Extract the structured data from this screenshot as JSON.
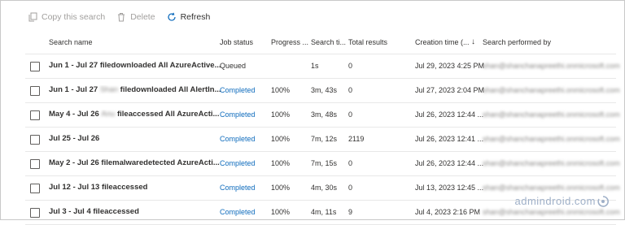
{
  "toolbar": {
    "copy_label": "Copy this search",
    "delete_label": "Delete",
    "refresh_label": "Refresh"
  },
  "columns": {
    "name": "Search name",
    "status": "Job status",
    "progress": "Progress ...",
    "search_time": "Search ti...",
    "total": "Total results",
    "created": "Creation time (...",
    "sort_indicator": "↓",
    "performed_by": "Search performed by"
  },
  "rows": [
    {
      "name": "Jun 1 - Jul 27 filedownloaded All AzureActive...",
      "name_blur": "",
      "status": "Queued",
      "status_done": false,
      "progress": "",
      "search_time": "1s",
      "total": "0",
      "created": "Jul 29, 2023 4:25 PM",
      "performed_by": "shan@shanchanapreethi.onmicrosoft.com"
    },
    {
      "name": "Jun 1 - Jul 27",
      "name_blur": "Shan",
      "name_rest": " filedownloaded All AlertIn...",
      "status": "Completed",
      "status_done": true,
      "progress": "100%",
      "search_time": "3m, 43s",
      "total": "0",
      "created": "Jul 27, 2023 2:04 PM",
      "performed_by": "shan@shanchanapreethi.onmicrosoft.com"
    },
    {
      "name": "May 4 - Jul 26",
      "name_blur": "Anu",
      "name_rest": " fileaccessed All AzureActi...",
      "status": "Completed",
      "status_done": true,
      "progress": "100%",
      "search_time": "3m, 48s",
      "total": "0",
      "created": "Jul 26, 2023 12:44 ...",
      "performed_by": "shan@shanchanapreethi.onmicrosoft.com"
    },
    {
      "name": "Jul 25 - Jul 26",
      "name_blur": "",
      "status": "Completed",
      "status_done": true,
      "progress": "100%",
      "search_time": "7m, 12s",
      "total": "2119",
      "created": "Jul 26, 2023 12:41 ...",
      "performed_by": "shan@shanchanapreethi.onmicrosoft.com"
    },
    {
      "name": "May 2 - Jul 26 filemalwaredetected AzureActi...",
      "name_blur": "",
      "status": "Completed",
      "status_done": true,
      "progress": "100%",
      "search_time": "7m, 15s",
      "total": "0",
      "created": "Jul 26, 2023 12:44 ...",
      "performed_by": "shan@shanchanapreethi.onmicrosoft.com"
    },
    {
      "name": "Jul 12 - Jul 13 fileaccessed",
      "name_blur": "",
      "status": "Completed",
      "status_done": true,
      "progress": "100%",
      "search_time": "4m, 30s",
      "total": "0",
      "created": "Jul 13, 2023 12:45 ...",
      "performed_by": "shan@shanchanapreethi.onmicrosoft.com"
    },
    {
      "name": "Jul 3 - Jul 4 fileaccessed",
      "name_blur": "",
      "status": "Completed",
      "status_done": true,
      "progress": "100%",
      "search_time": "4m, 11s",
      "total": "9",
      "created": "Jul 4, 2023 2:16 PM",
      "performed_by": "shan@shanchanapreethi.onmicrosoft.com"
    }
  ],
  "watermark": "admindroid.com",
  "colors": {
    "link": "#0f6cbd",
    "disabled": "#a19f9d",
    "border": "#e8e8e8"
  }
}
